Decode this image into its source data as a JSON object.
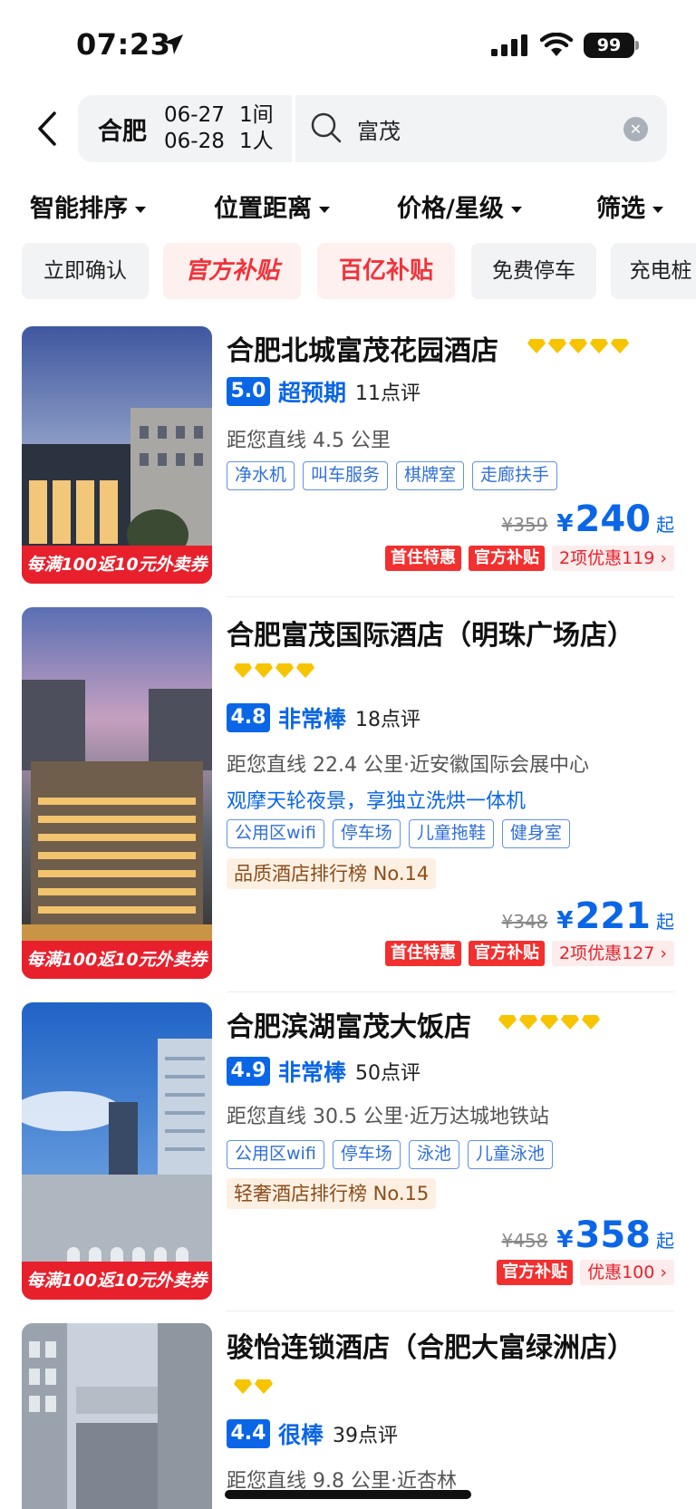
{
  "status_bar": {
    "time": "07:23",
    "battery": "99"
  },
  "search": {
    "city": "合肥",
    "checkin": "06-27",
    "checkout": "06-28",
    "rooms": "1间",
    "guests": "1人",
    "keyword": "富茂"
  },
  "sort_bar": [
    "智能排序",
    "位置距离",
    "价格/星级",
    "筛选"
  ],
  "chips": [
    "立即确认",
    "官方补贴",
    "百亿补贴",
    "免费停车",
    "充电桩"
  ],
  "thumb_banner": "每满100返10元外卖券",
  "hotels": [
    {
      "name": "合肥北城富茂花园酒店",
      "stars": 5,
      "score": "5.0",
      "score_text": "超预期",
      "reviews": "11点评",
      "distance": "距您直线 4.5 公里",
      "tags": [
        "净水机",
        "叫车服务",
        "棋牌室",
        "走廊扶手"
      ],
      "old_price": "¥359",
      "currency": "¥",
      "price": "240",
      "price_suffix": "起",
      "promos": [
        "首住特惠",
        "官方补贴"
      ],
      "discount": "2项优惠119 ›"
    },
    {
      "name": "合肥富茂国际酒店（明珠广场店）",
      "stars": 4,
      "score": "4.8",
      "score_text": "非常棒",
      "reviews": "18点评",
      "distance": "距您直线 22.4 公里·近安徽国际会展中心",
      "slogan": "观摩天轮夜景，享独立洗烘一体机",
      "tags": [
        "公用区wifi",
        "停车场",
        "儿童拖鞋",
        "健身室"
      ],
      "rank": "品质酒店排行榜 No.14",
      "old_price": "¥348",
      "currency": "¥",
      "price": "221",
      "price_suffix": "起",
      "promos": [
        "首住特惠",
        "官方补贴"
      ],
      "discount": "2项优惠127 ›"
    },
    {
      "name": "合肥滨湖富茂大饭店",
      "stars": 5,
      "score": "4.9",
      "score_text": "非常棒",
      "reviews": "50点评",
      "distance": "距您直线 30.5 公里·近万达城地铁站",
      "tags": [
        "公用区wifi",
        "停车场",
        "泳池",
        "儿童泳池"
      ],
      "rank": "轻奢酒店排行榜 No.15",
      "old_price": "¥458",
      "currency": "¥",
      "price": "358",
      "price_suffix": "起",
      "promos": [
        "官方补贴"
      ],
      "discount": "优惠100 ›"
    },
    {
      "name": "骏怡连锁酒店（合肥大富绿洲店）",
      "stars": 2,
      "score": "4.4",
      "score_text": "很棒",
      "reviews": "39点评",
      "distance": "距您直线 9.8 公里·近杏林"
    }
  ],
  "colors": {
    "accent_blue": "#0a66e6",
    "promo_red": "#f2302f",
    "star_gold": "#f7c400"
  }
}
